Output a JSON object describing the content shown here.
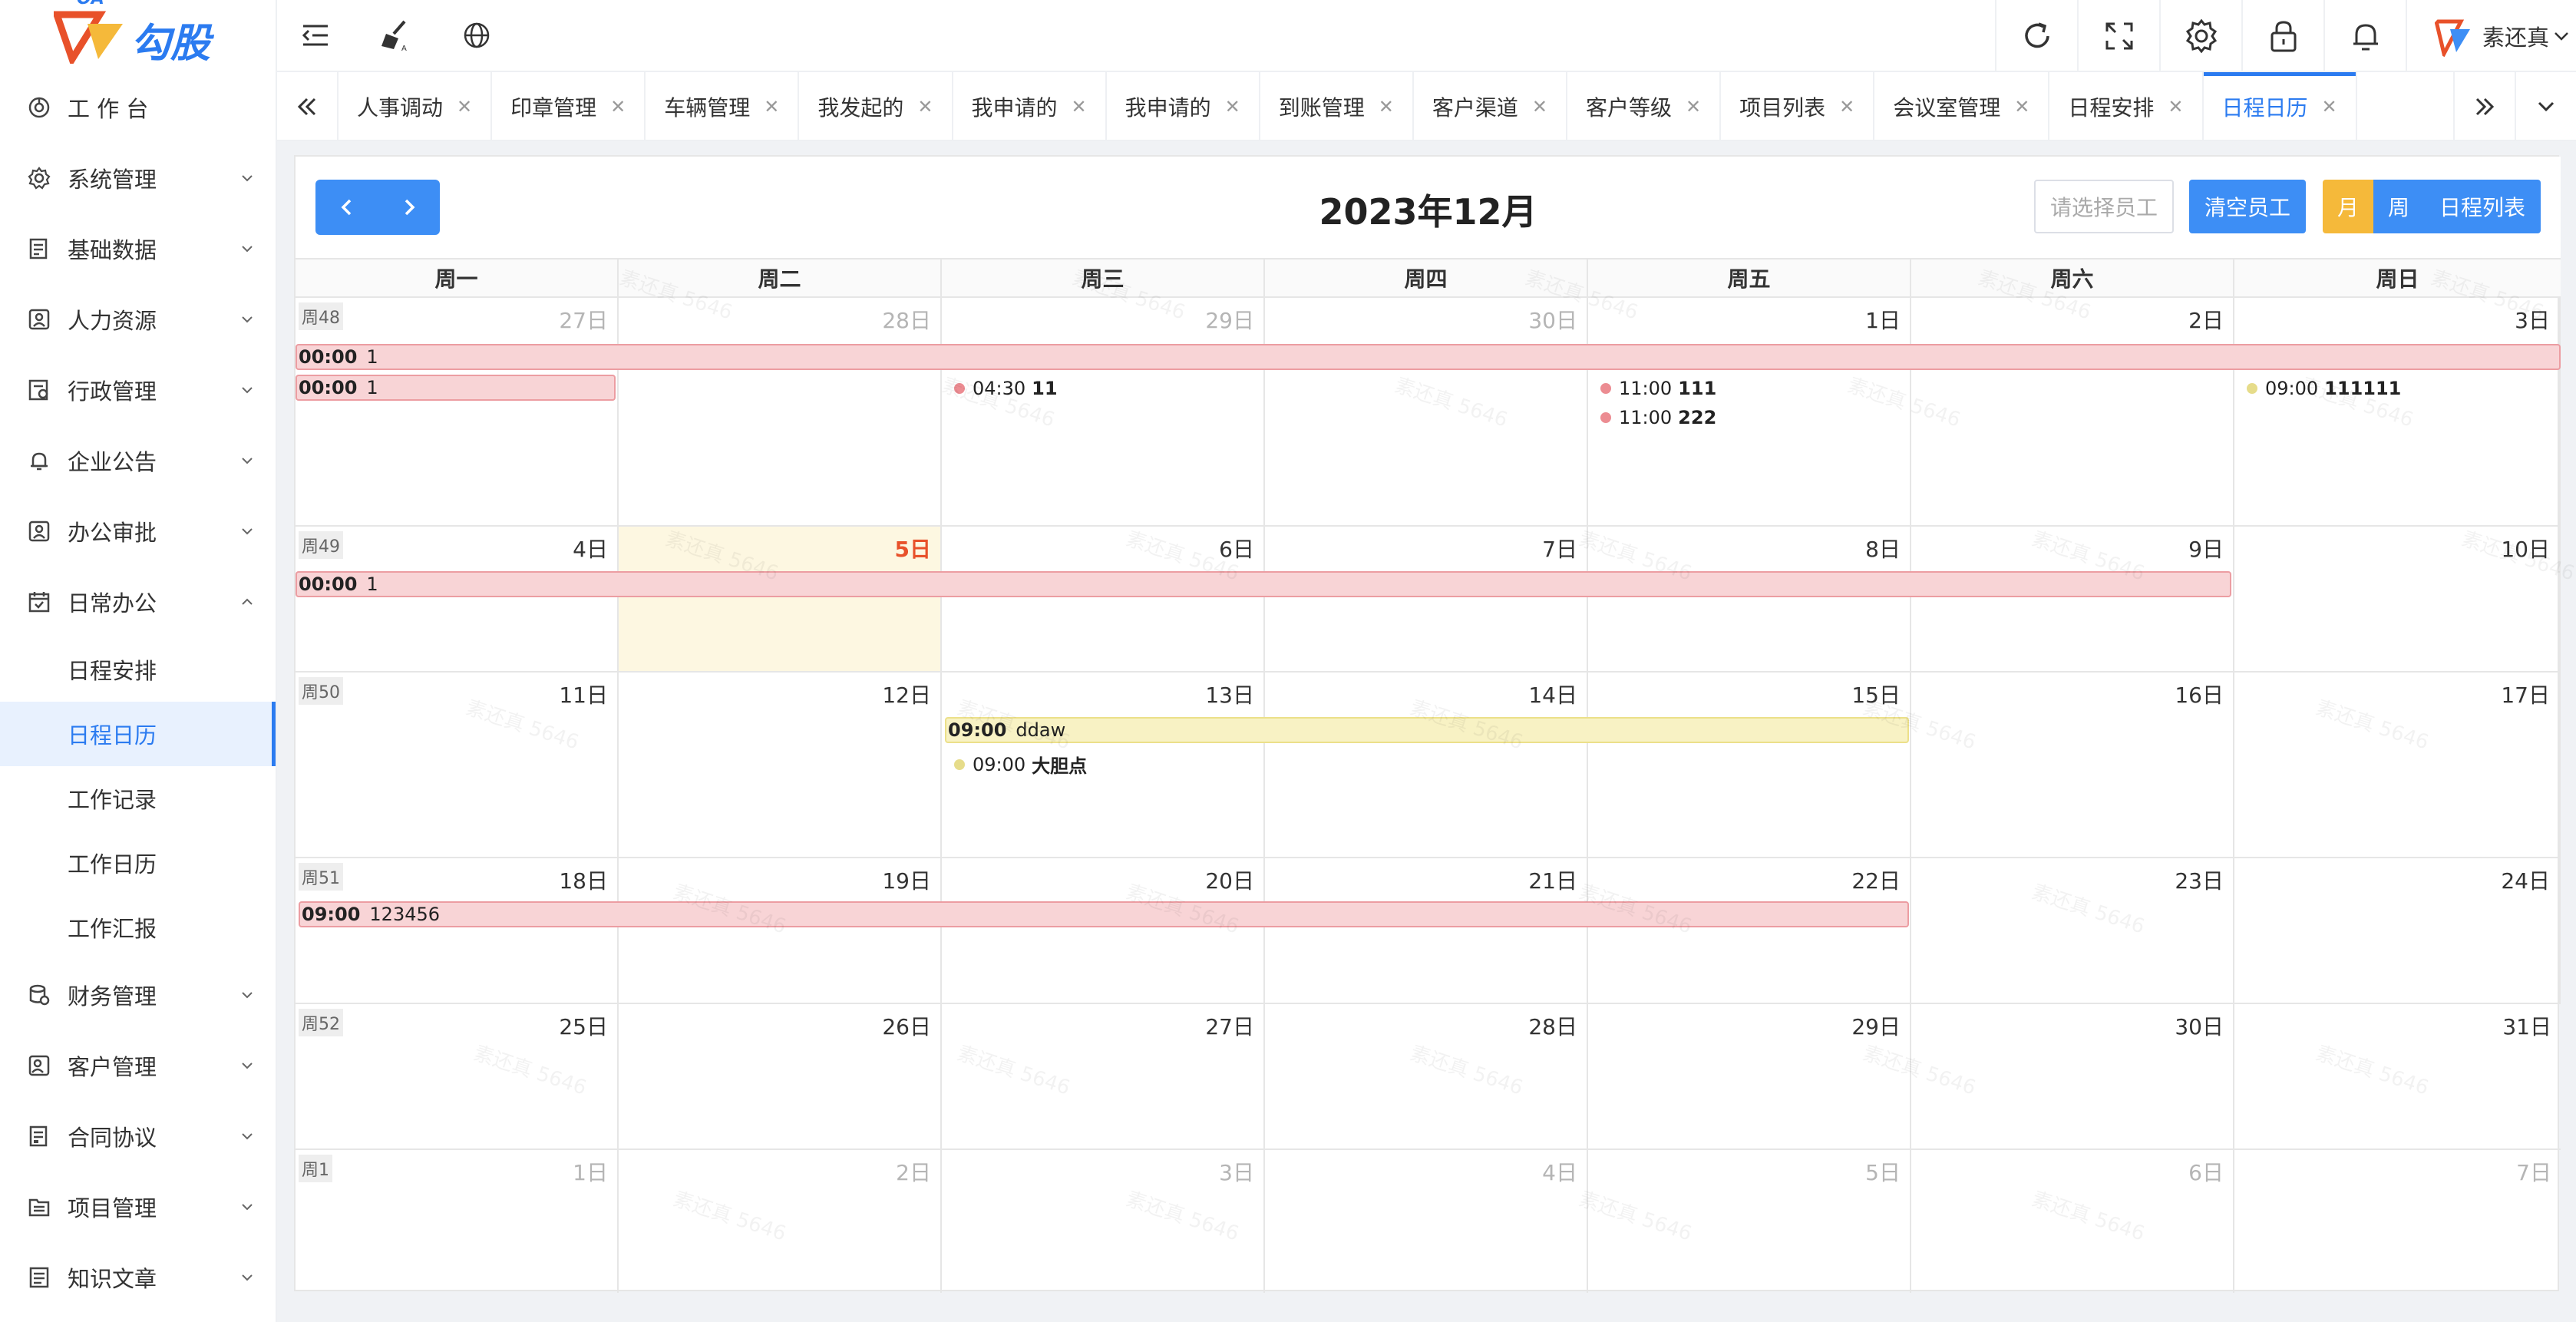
{
  "app": {
    "logo_text": "勾股",
    "logo_oa": "OA"
  },
  "sidebar": {
    "items": [
      {
        "label": "工 作 台",
        "icon": "dashboard-icon"
      },
      {
        "label": "系统管理",
        "icon": "gear-icon"
      },
      {
        "label": "基础数据",
        "icon": "data-icon"
      },
      {
        "label": "人力资源",
        "icon": "person-icon"
      },
      {
        "label": "行政管理",
        "icon": "admin-icon"
      },
      {
        "label": "企业公告",
        "icon": "bell-icon"
      },
      {
        "label": "办公审批",
        "icon": "approval-icon"
      },
      {
        "label": "日常办公",
        "icon": "calendar-icon"
      }
    ],
    "sub_items": [
      "日程安排",
      "日程日历",
      "工作记录",
      "工作日历",
      "工作汇报"
    ],
    "items_after": [
      {
        "label": "财务管理",
        "icon": "finance-icon"
      },
      {
        "label": "客户管理",
        "icon": "customer-icon"
      },
      {
        "label": "合同协议",
        "icon": "contract-icon"
      },
      {
        "label": "项目管理",
        "icon": "project-icon"
      },
      {
        "label": "知识文章",
        "icon": "article-icon"
      }
    ]
  },
  "header": {
    "username": "素还真"
  },
  "tabs": [
    "人事调动",
    "印章管理",
    "车辆管理",
    "我发起的",
    "我申请的",
    "我申请的",
    "到账管理",
    "客户渠道",
    "客户等级",
    "项目列表",
    "会议室管理",
    "日程安排",
    "日程日历"
  ],
  "active_tab": "日程日历",
  "calendar": {
    "title": "2023年12月",
    "employee_placeholder": "请选择员工",
    "clear_label": "清空员工",
    "views": [
      "月",
      "周",
      "日程列表"
    ],
    "active_view": "月",
    "weekdays": [
      "周一",
      "周二",
      "周三",
      "周四",
      "周五",
      "周六",
      "周日"
    ],
    "weeks": [
      {
        "label": "周48",
        "days": [
          "27日",
          "28日",
          "29日",
          "30日",
          "1日",
          "2日",
          "3日"
        ]
      },
      {
        "label": "周49",
        "days": [
          "4日",
          "5日",
          "6日",
          "7日",
          "8日",
          "9日",
          "10日"
        ]
      },
      {
        "label": "周50",
        "days": [
          "11日",
          "12日",
          "13日",
          "14日",
          "15日",
          "16日",
          "17日"
        ]
      },
      {
        "label": "周51",
        "days": [
          "18日",
          "19日",
          "20日",
          "21日",
          "22日",
          "23日",
          "24日"
        ]
      },
      {
        "label": "周52",
        "days": [
          "25日",
          "26日",
          "27日",
          "28日",
          "29日",
          "30日",
          "31日"
        ]
      },
      {
        "label": "周1",
        "days": [
          "1日",
          "2日",
          "3日",
          "4日",
          "5日",
          "6日",
          "7日"
        ]
      }
    ],
    "events": {
      "w48_bar1": {
        "time": "00:00",
        "title": "1"
      },
      "w48_bar2": {
        "time": "00:00",
        "title": "1"
      },
      "w48_dot_wed": {
        "time": "04:30",
        "title": "11"
      },
      "w48_dot_fri1": {
        "time": "11:00",
        "title": "111"
      },
      "w48_dot_fri2": {
        "time": "11:00",
        "title": "222"
      },
      "w48_dot_sun": {
        "time": "09:00",
        "title": "111111"
      },
      "w49_bar": {
        "time": "00:00",
        "title": "1"
      },
      "w50_bar": {
        "time": "09:00",
        "title": "ddaw"
      },
      "w50_dot": {
        "time": "09:00",
        "title": "大胆点"
      },
      "w51_bar": {
        "time": "09:00",
        "title": "123456"
      }
    },
    "colors": {
      "pink_dot": "#ec8c92",
      "yellow_dot": "#e6dc8a",
      "today_bg": "#fdf7e1",
      "today_num": "#e8512a"
    }
  },
  "watermark": "素还真 5646"
}
